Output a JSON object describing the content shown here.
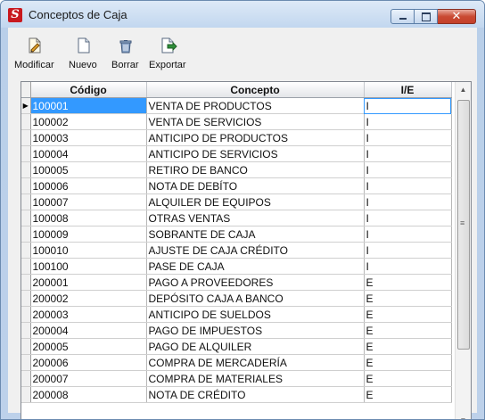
{
  "window": {
    "title": "Conceptos de Caja",
    "min_glyph": "",
    "close_glyph": "✕"
  },
  "toolbar": {
    "modify_label": "Modificar",
    "new_label": "Nuevo",
    "delete_label": "Borrar",
    "export_label": "Exportar"
  },
  "grid": {
    "columns": [
      "Código",
      "Concepto",
      "I/E"
    ],
    "current_row_marker": "▶",
    "rows": [
      {
        "code": "100001",
        "concept": "VENTA DE PRODUCTOS",
        "ie": "I"
      },
      {
        "code": "100002",
        "concept": "VENTA DE SERVICIOS",
        "ie": "I"
      },
      {
        "code": "100003",
        "concept": "ANTICIPO DE PRODUCTOS",
        "ie": "I"
      },
      {
        "code": "100004",
        "concept": "ANTICIPO DE SERVICIOS",
        "ie": "I"
      },
      {
        "code": "100005",
        "concept": "RETIRO DE BANCO",
        "ie": "I"
      },
      {
        "code": "100006",
        "concept": "NOTA DE DEBÍTO",
        "ie": "I"
      },
      {
        "code": "100007",
        "concept": "ALQUILER DE EQUIPOS",
        "ie": "I"
      },
      {
        "code": "100008",
        "concept": "OTRAS VENTAS",
        "ie": "I"
      },
      {
        "code": "100009",
        "concept": "SOBRANTE DE CAJA",
        "ie": "I"
      },
      {
        "code": "100010",
        "concept": "AJUSTE DE CAJA CRÉDITO",
        "ie": "I"
      },
      {
        "code": "100100",
        "concept": "PASE DE CAJA",
        "ie": "I"
      },
      {
        "code": "200001",
        "concept": "PAGO A PROVEEDORES",
        "ie": "E"
      },
      {
        "code": "200002",
        "concept": "DEPÓSITO CAJA A BANCO",
        "ie": "E"
      },
      {
        "code": "200003",
        "concept": "ANTICIPO DE SUELDOS",
        "ie": "E"
      },
      {
        "code": "200004",
        "concept": "PAGO DE IMPUESTOS",
        "ie": "E"
      },
      {
        "code": "200005",
        "concept": "PAGO DE ALQUILER",
        "ie": "E"
      },
      {
        "code": "200006",
        "concept": "COMPRA DE MERCADERÍA",
        "ie": "E"
      },
      {
        "code": "200007",
        "concept": "COMPRA DE MATERIALES",
        "ie": "E"
      },
      {
        "code": "200008",
        "concept": "NOTA DE CRÉDITO",
        "ie": "E"
      }
    ]
  },
  "scrollbar": {
    "up_glyph": "▲",
    "down_glyph": "▼",
    "grip_glyph": "≡"
  }
}
